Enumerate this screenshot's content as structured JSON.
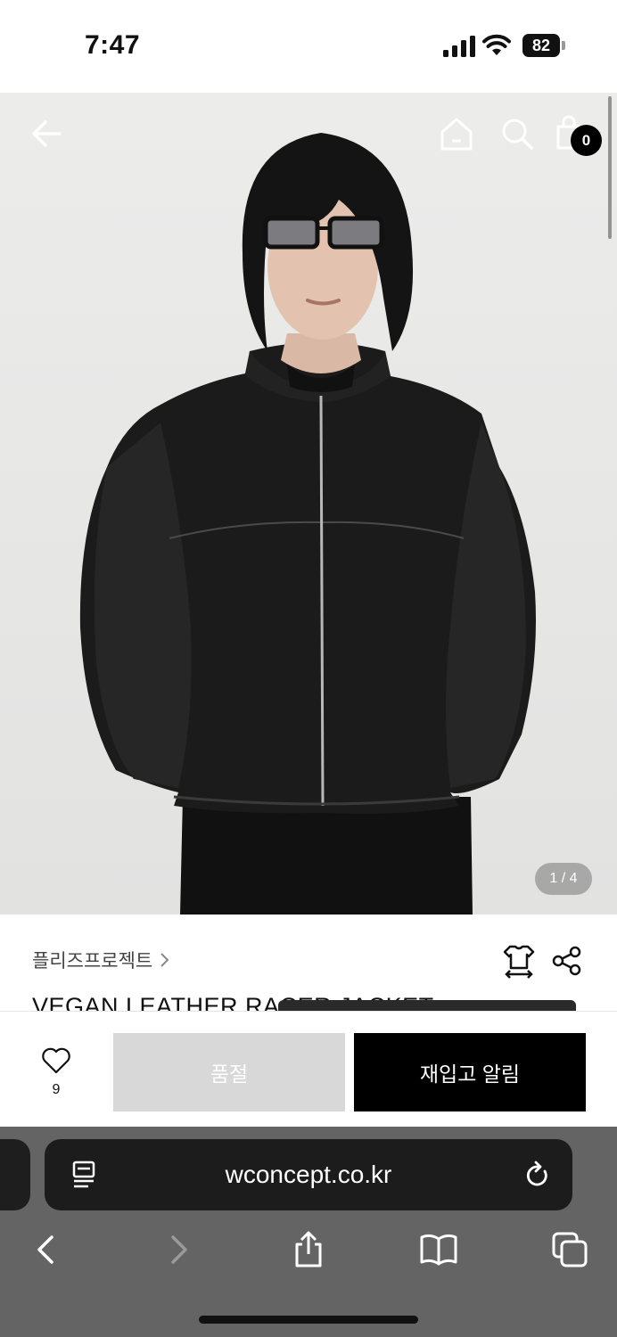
{
  "status_bar": {
    "time": "7:47",
    "battery": "82"
  },
  "hero": {
    "page_indicator": "1 / 4",
    "cart_count": "0"
  },
  "product": {
    "brand": "플리즈프로젝트",
    "title": "VEGAN LEATHER RACER JACKET"
  },
  "actions": {
    "wish_count": "9",
    "soldout_label": "품절",
    "restock_label": "재입고 알림"
  },
  "browser": {
    "url": "wconcept.co.kr"
  },
  "colors": {
    "accent": "#000000",
    "soldout_bg": "#d8d8d8",
    "browser_bg": "#646464"
  },
  "icons": [
    "back-arrow-icon",
    "home-icon",
    "search-icon",
    "shopping-bag-icon",
    "chevron-right-icon",
    "size-guide-icon",
    "share-icon",
    "heart-icon",
    "reader-icon",
    "reload-icon",
    "chevron-left-icon",
    "share-upload-icon",
    "bookmarks-icon",
    "tabs-icon"
  ]
}
